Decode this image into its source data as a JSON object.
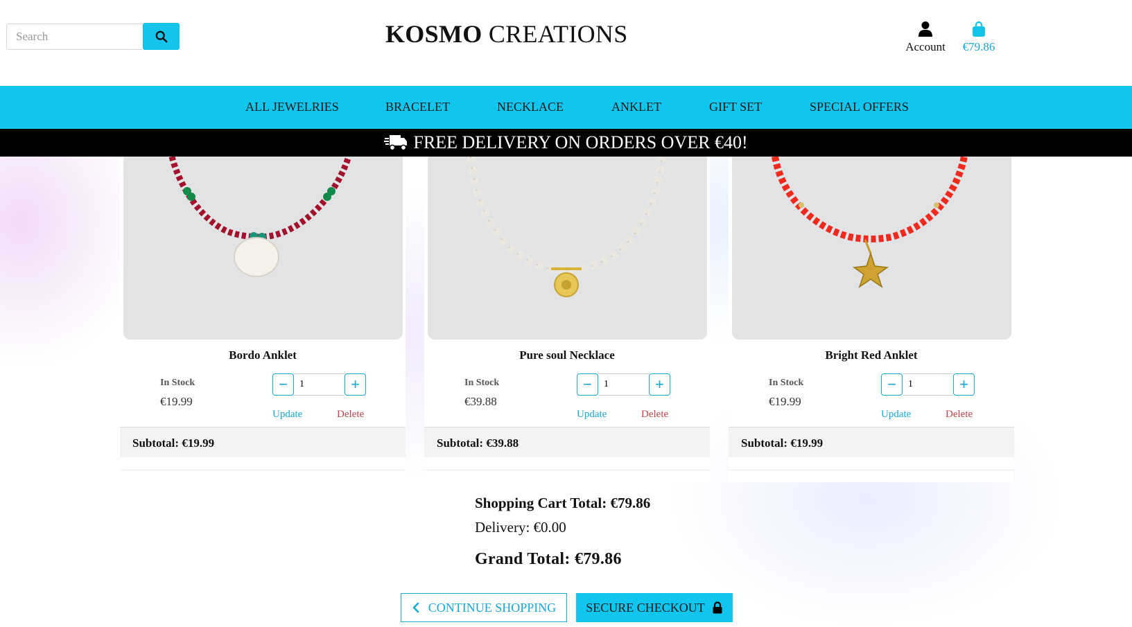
{
  "header": {
    "search_placeholder": "Search",
    "logo_bold": "KOSMO",
    "logo_rest": " CREATIONS",
    "account_label": "Account",
    "cart_total": "€79.86"
  },
  "nav": {
    "items": [
      "ALL JEWELRIES",
      "BRACELET",
      "NECKLACE",
      "ANKLET",
      "GIFT SET",
      "SPECIAL OFFERS"
    ]
  },
  "banner": {
    "text": "FREE DELIVERY ON ORDERS OVER €40!"
  },
  "items": [
    {
      "name": "Bordo Anklet",
      "stock": "In Stock",
      "price": "€19.99",
      "qty": "1",
      "update": "Update",
      "delete": "Delete",
      "subtotal": "Subtotal: €19.99"
    },
    {
      "name": "Pure soul Necklace",
      "stock": "In Stock",
      "price": "€39.88",
      "qty": "1",
      "update": "Update",
      "delete": "Delete",
      "subtotal": "Subtotal: €39.88"
    },
    {
      "name": "Bright Red Anklet",
      "stock": "In Stock",
      "price": "€19.99",
      "qty": "1",
      "update": "Update",
      "delete": "Delete",
      "subtotal": "Subtotal: €19.99"
    }
  ],
  "totals": {
    "cart_total": "Shopping Cart Total: €79.86",
    "delivery": "Delivery: €0.00",
    "grand_total": "Grand Total: €79.86"
  },
  "actions": {
    "continue_label": "CONTINUE SHOPPING",
    "checkout_label": "SECURE CHECKOUT"
  },
  "colors": {
    "accent": "#11c6ee",
    "link": "#14a8d6",
    "delete": "#c2404a",
    "banner": "#000000"
  }
}
